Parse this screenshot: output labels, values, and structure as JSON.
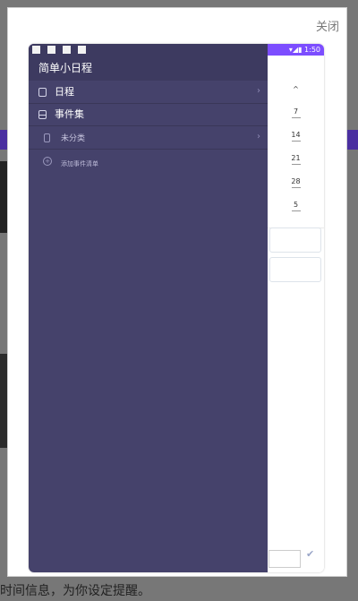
{
  "lightbox": {
    "close_label": "关闭"
  },
  "phone": {
    "status_time": "1:50",
    "status_icons_right": "▾◢▮"
  },
  "drawer": {
    "title": "简单小日程",
    "items": [
      {
        "label": "日程",
        "icon": "calendar-icon",
        "has_chevron": true
      },
      {
        "label": "事件集",
        "icon": "folder-icon",
        "has_chevron": false
      },
      {
        "label": "未分类",
        "icon": "document-icon",
        "has_chevron": true
      },
      {
        "label": "添加事件清单",
        "icon": "add-circle-icon",
        "has_chevron": false
      }
    ]
  },
  "calendar": {
    "dates": [
      "7",
      "14",
      "21",
      "28",
      "5"
    ]
  },
  "background": {
    "caption": "时间信息，为你设定提醒。"
  },
  "colors": {
    "drawer_bg": "#45426b",
    "drawer_header_bg": "#3d3a60",
    "accent": "#7c4dff"
  }
}
